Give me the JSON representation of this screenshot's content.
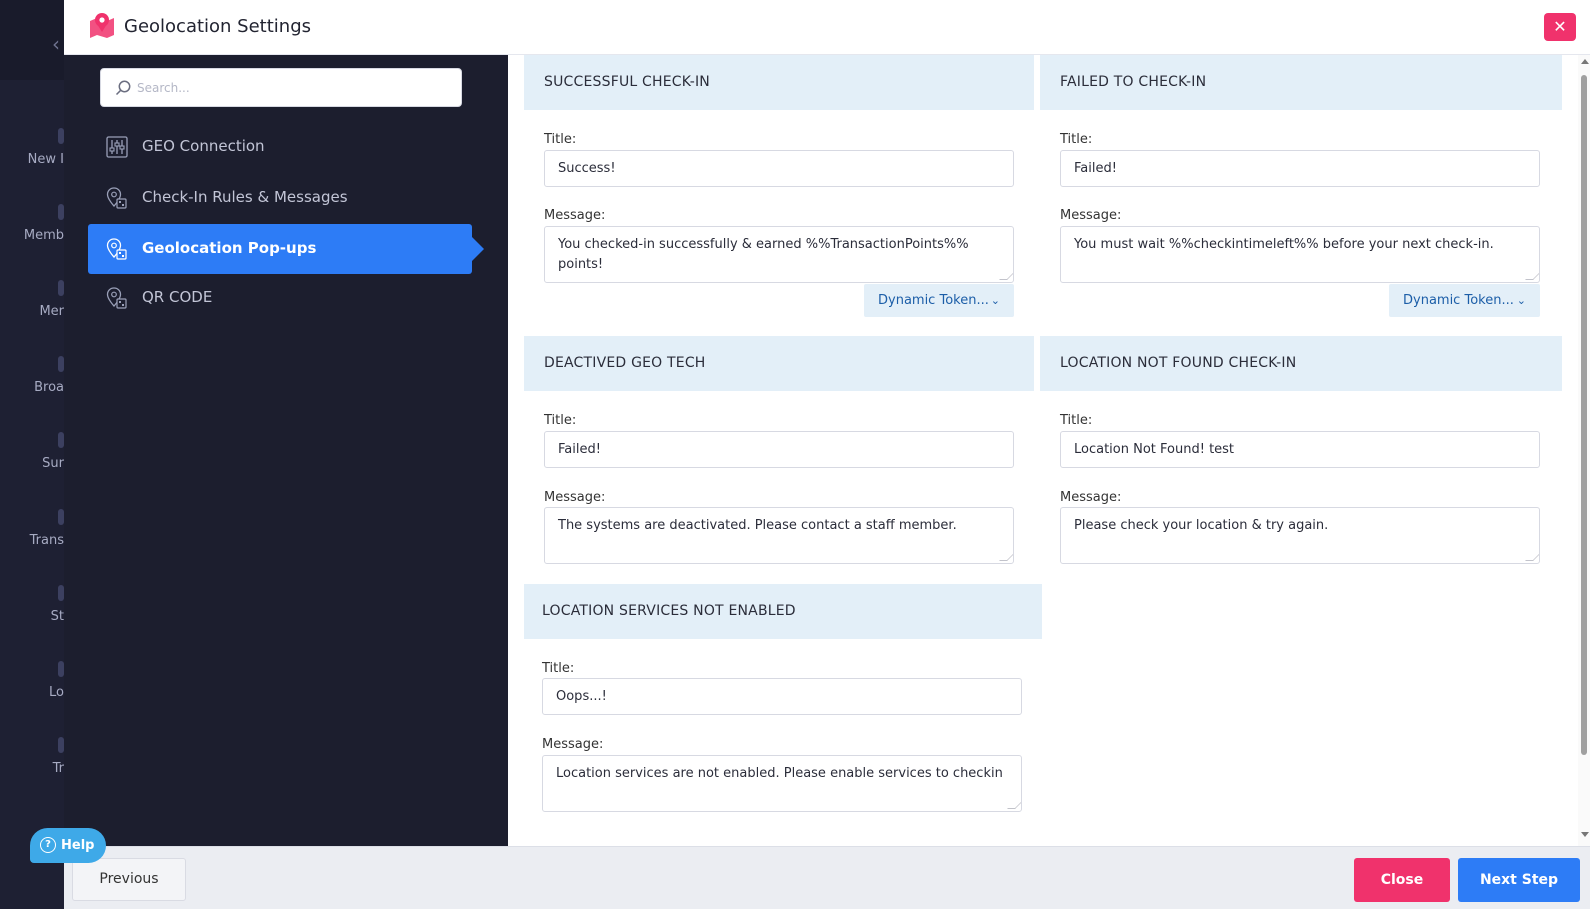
{
  "background_nav": {
    "items": [
      "New I",
      "Memb",
      "Mer",
      "Broa",
      "Sur",
      "Trans",
      "St",
      "Lo",
      "Tr"
    ]
  },
  "modal": {
    "title": "Geolocation Settings",
    "header_icon": "map-pin-icon",
    "close_icon": "close-icon",
    "close_symbol": "✕"
  },
  "search": {
    "placeholder": "Search..."
  },
  "nav": {
    "items": [
      {
        "label": "GEO Connection",
        "icon": "sliders-icon"
      },
      {
        "label": "Check-In Rules & Messages",
        "icon": "location-pin-icon"
      },
      {
        "label": "Geolocation Pop-ups",
        "icon": "location-pin-icon",
        "active": true
      },
      {
        "label": "QR CODE",
        "icon": "location-pin-icon"
      }
    ]
  },
  "labels": {
    "title": "Title:",
    "message": "Message:",
    "dynamic_token": "Dynamic Token...",
    "chevron": "⌄"
  },
  "sections": {
    "successful": {
      "heading": "SUCCESSFUL CHECK-IN",
      "title": "Success!",
      "message": "You checked-in successfully & earned %%TransactionPoints%% points!"
    },
    "failed": {
      "heading": "FAILED TO CHECK-IN",
      "title": "Failed!",
      "message": "You must wait %%checkintimeleft%% before your next check-in."
    },
    "deactivated": {
      "heading": "DEACTIVED GEO TECH",
      "title": "Failed!",
      "message": "The systems are deactivated. Please contact a staff member."
    },
    "not_found": {
      "heading": "LOCATION NOT FOUND CHECK-IN",
      "title": "Location Not Found! test",
      "message": "Please check your location & try again."
    },
    "not_enabled": {
      "heading": "LOCATION SERVICES NOT ENABLED",
      "title": "Oops...!",
      "message": "Location services are not enabled. Please enable services to checkin"
    }
  },
  "footer": {
    "previous": "Previous",
    "close": "Close",
    "next": "Next Step"
  },
  "help": {
    "label": "Help",
    "icon": "question-circle-icon",
    "symbol": "?"
  },
  "colors": {
    "primary": "#2d7cf6",
    "danger": "#f0326c",
    "nav_bg": "#1c1e2e",
    "section_head": "#e3eff8",
    "help": "#3ea9e8"
  }
}
